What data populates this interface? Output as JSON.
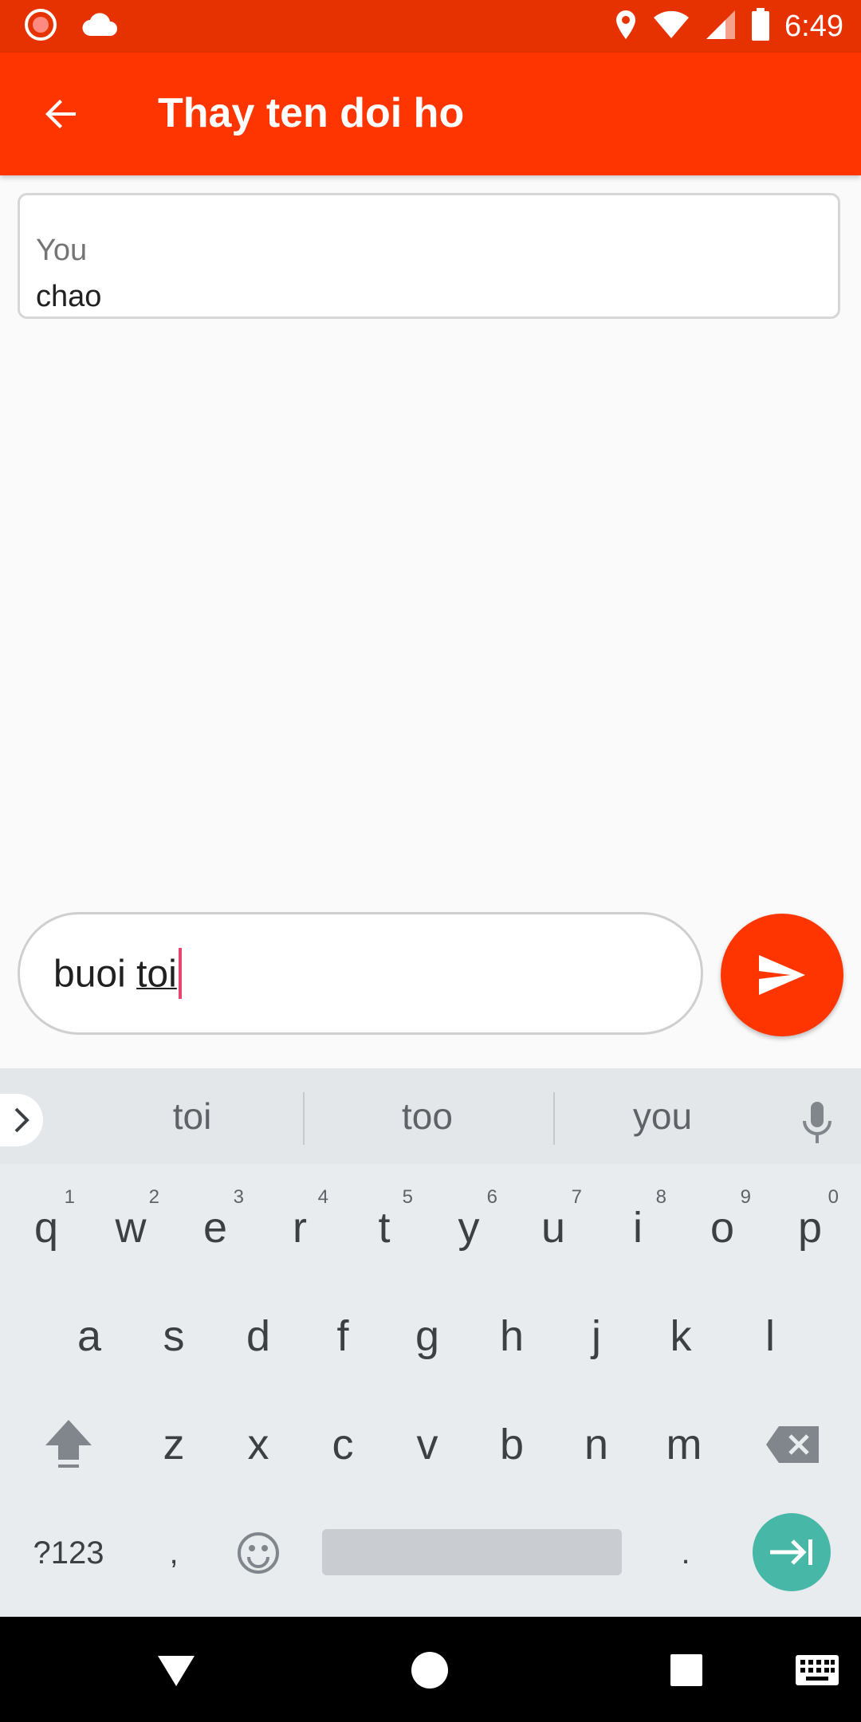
{
  "status_bar": {
    "time": "6:49"
  },
  "app_bar": {
    "title": "Thay ten doi ho"
  },
  "messages": [
    {
      "sender": "You",
      "text": "chao"
    }
  ],
  "composer": {
    "text_before": "buoi ",
    "text_composing": "toi"
  },
  "keyboard": {
    "suggestions": [
      "toi",
      "too",
      "you"
    ],
    "row1": [
      {
        "key": "q",
        "hint": "1"
      },
      {
        "key": "w",
        "hint": "2"
      },
      {
        "key": "e",
        "hint": "3"
      },
      {
        "key": "r",
        "hint": "4"
      },
      {
        "key": "t",
        "hint": "5"
      },
      {
        "key": "y",
        "hint": "6"
      },
      {
        "key": "u",
        "hint": "7"
      },
      {
        "key": "i",
        "hint": "8"
      },
      {
        "key": "o",
        "hint": "9"
      },
      {
        "key": "p",
        "hint": "0"
      }
    ],
    "row2": [
      "a",
      "s",
      "d",
      "f",
      "g",
      "h",
      "j",
      "k",
      "l"
    ],
    "row3": [
      "z",
      "x",
      "c",
      "v",
      "b",
      "n",
      "m"
    ],
    "symbols_key": "?123",
    "comma_key": ",",
    "period_key": "."
  },
  "colors": {
    "status_bar": "#e63200",
    "app_bar": "#ff3500",
    "send_button": "#ff3500",
    "enter_key": "#47b8a8",
    "caret": "#e8466f"
  }
}
